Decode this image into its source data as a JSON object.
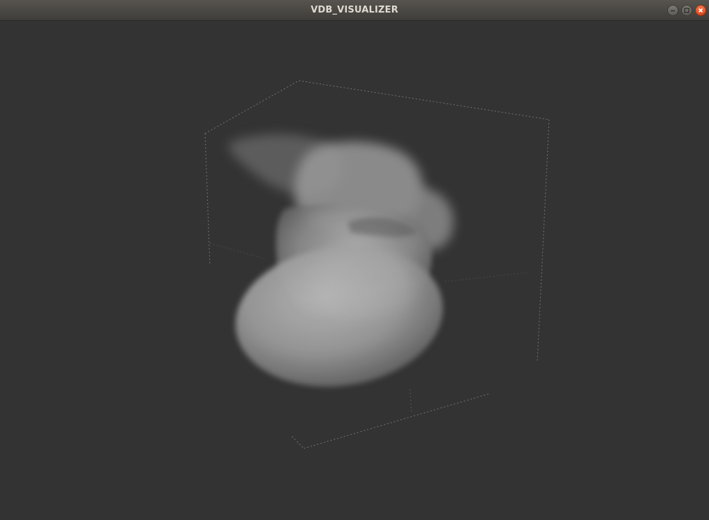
{
  "window": {
    "title": "VDB_VISUALIZER",
    "controls": {
      "minimize_icon": "minimize-icon",
      "maximize_icon": "maximize-icon",
      "close_icon": "close-icon"
    }
  },
  "viewport": {
    "background_color": "#333333",
    "bounding_box_color": "#8a8a8a",
    "volume_color": "#bdbdbd"
  }
}
